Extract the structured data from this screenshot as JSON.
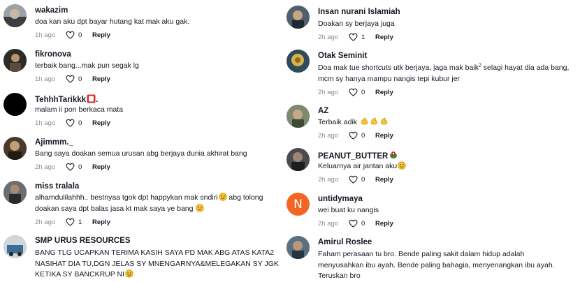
{
  "comments": [
    {
      "username": "wakazim",
      "text": "doa kan aku dpt bayar hutang kat mak aku gak.",
      "time": "1h ago",
      "likes": "0",
      "reply": "Reply"
    },
    {
      "username": "fikronova",
      "text": "terbaik bang...mak pun segak lg",
      "time": "1h ago",
      "likes": "0",
      "reply": "Reply"
    },
    {
      "username": "TehhhTarikkk",
      "text": "malam ii pon berkaca mata",
      "time": "1h ago",
      "likes": "0",
      "reply": "Reply"
    },
    {
      "username": "Ajimmm._",
      "text": "Bang saya doakan semua urusan abg berjaya dunia akhirat bang",
      "time": "2h ago",
      "likes": "0",
      "reply": "Reply"
    },
    {
      "username": "miss tralala",
      "text_line1": "alhamdulilahhh.. bestnyaa tgok dpt happykan mak sndiri",
      "text_line1b": " abg tolong",
      "text_line2": "doakan saya dpt balas jasa kt mak saya ye bang ",
      "time": "2h ago",
      "likes": "1",
      "reply": "Reply"
    },
    {
      "username": "SMP URUS RESOURCES",
      "text_line1": "BANG TLG UCAPKAN TERIMA KASIH SAYA PD MAK ABG ATAS KATA2",
      "text_line2": "NASIHAT DIA TU,DGN JELAS SY MNENGARNYA&MELEGAKAN SY JGK",
      "text_line3": "KETIKA SY BANCKRUP NI"
    },
    {
      "username": "Insan nurani Islamiah",
      "text": "Doakan sy berjaya juga",
      "time": "2h ago",
      "likes": "1",
      "reply": "Reply"
    },
    {
      "username": "Otak Seminit",
      "text_line1a": "Doa mak tue shortcuts utk berjaya, jaga mak baik",
      "text_sup": "2",
      "text_line1b": " selagi hayat dia ada bang,",
      "text_line2": "mcm sy hanya mampu nangis tepi kubur jer",
      "time": "2h ago",
      "likes": "0",
      "reply": "Reply"
    },
    {
      "username": "AZ",
      "text": "Terbaik adik ",
      "time": "2h ago",
      "likes": "0",
      "reply": "Reply"
    },
    {
      "username": "PEANUT_BUTTER",
      "text": "Keluarnya air jantan aku",
      "time": "2h ago",
      "likes": "0",
      "reply": "Reply"
    },
    {
      "username": "untidymaya",
      "avatar_initial": "N",
      "text": "wei buat ku nangis",
      "time": "2h ago",
      "likes": "0",
      "reply": "Reply"
    },
    {
      "username": "Amirul Roslee",
      "text_line1": "Faham perasaan tu bro. Bende paling sakit dalam hidup adalah",
      "text_line2": "menyusahkan ibu ayah. Bende paling bahagia, menyenangkan ibu ayah.",
      "text_line3": "Teruskan bro"
    }
  ],
  "colors": {
    "username": "#161823",
    "meta": "#8a8b91",
    "avatar_initial_bg": "#f26522"
  }
}
